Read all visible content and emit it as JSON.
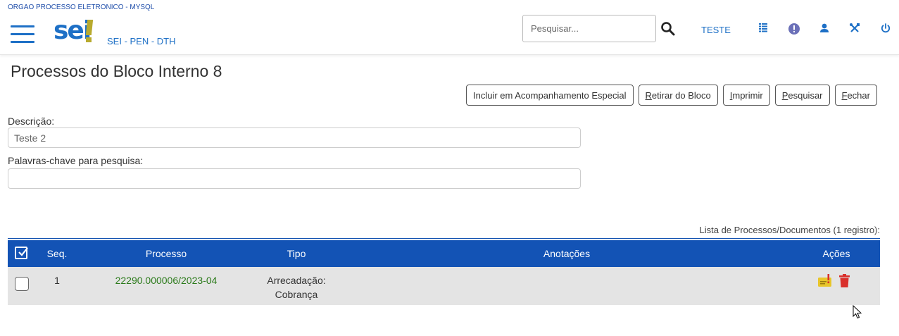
{
  "header": {
    "org": "ORGAO PROCESSO ELETRONICO - MYSQL",
    "logo_text": "sei",
    "unit": "SEI - PEN - DTH",
    "search_placeholder": "Pesquisar...",
    "user": "TESTE",
    "icons": [
      "search-icon",
      "menu-grid-icon",
      "info-alert-icon",
      "user-icon",
      "tools-icon",
      "power-icon"
    ]
  },
  "page": {
    "title": "Processos do Bloco Interno 8"
  },
  "buttons": {
    "acompanhamento": "Incluir em Acompanhamento Especial",
    "retirar_key": "R",
    "retirar_rest": "etirar do Bloco",
    "imprimir_key": "I",
    "imprimir_rest": "mprimir",
    "pesquisar_key": "P",
    "pesquisar_rest": "esquisar",
    "fechar_key": "F",
    "fechar_rest": "echar"
  },
  "form": {
    "descricao_label": "Descrição:",
    "descricao_value": "Teste 2",
    "palavras_label": "Palavras-chave para pesquisa:",
    "palavras_value": ""
  },
  "table": {
    "caption": "Lista de Processos/Documentos (1 registro):",
    "headers": {
      "seq": "Seq.",
      "processo": "Processo",
      "tipo": "Tipo",
      "anotacoes": "Anotações",
      "acoes": "Ações"
    },
    "rows": [
      {
        "seq": "1",
        "processo": "22290.000006/2023-04",
        "tipo_line1": "Arrecadação:",
        "tipo_line2": "Cobrança",
        "anotacoes": ""
      }
    ]
  },
  "colors": {
    "brand_blue": "#1e70c6",
    "header_blue": "#1353b5",
    "link_green": "#2b7a1a",
    "logo_gold": "#b8aa2e",
    "row_bg": "#e4e4e4",
    "delete_red": "#d9302c",
    "note_yellow": "#e8c52a"
  }
}
